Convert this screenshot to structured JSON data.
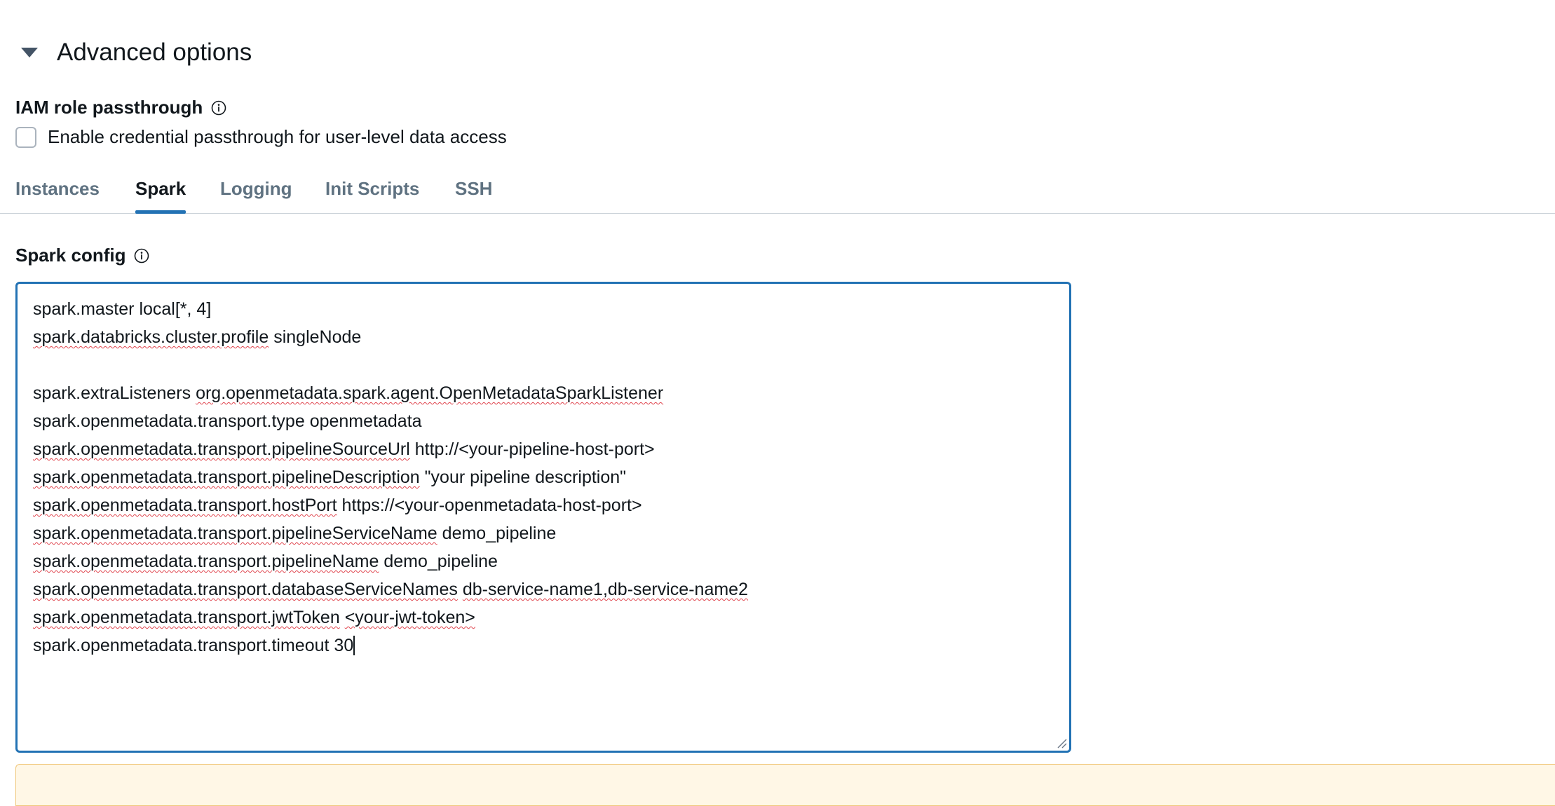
{
  "advanced_options": {
    "title": "Advanced options"
  },
  "iam": {
    "label": "IAM role passthrough",
    "checkbox_label": "Enable credential passthrough for user-level data access",
    "checked": false
  },
  "tabs": [
    {
      "label": "Instances",
      "active": false
    },
    {
      "label": "Spark",
      "active": true
    },
    {
      "label": "Logging",
      "active": false
    },
    {
      "label": "Init Scripts",
      "active": false
    },
    {
      "label": "SSH",
      "active": false
    }
  ],
  "spark_config": {
    "label": "Spark config",
    "lines": [
      {
        "key": "spark.master",
        "value": "local[*, 4]"
      },
      {
        "key": "spark.databricks.cluster.profile",
        "value": "singleNode"
      },
      {
        "key": "",
        "value": ""
      },
      {
        "key": "spark.extraListeners",
        "value": "org.openmetadata.spark.agent.OpenMetadataSparkListener"
      },
      {
        "key": "spark.openmetadata.transport.type",
        "value": "openmetadata"
      },
      {
        "key": "spark.openmetadata.transport.pipelineSourceUrl",
        "value": "http://<your-pipeline-host-port>"
      },
      {
        "key": "spark.openmetadata.transport.pipelineDescription",
        "value": "\"your pipeline description\""
      },
      {
        "key": "spark.openmetadata.transport.hostPort",
        "value": "https://<your-openmetadata-host-port>"
      },
      {
        "key": "spark.openmetadata.transport.pipelineServiceName",
        "value": "demo_pipeline"
      },
      {
        "key": "spark.openmetadata.transport.pipelineName",
        "value": "demo_pipeline"
      },
      {
        "key": "spark.openmetadata.transport.databaseServiceNames",
        "value": "db-service-name1,db-service-name2"
      },
      {
        "key": "spark.openmetadata.transport.jwtToken",
        "value": "<your-jwt-token>"
      },
      {
        "key": "spark.openmetadata.transport.timeout",
        "value": "30"
      }
    ]
  },
  "colors": {
    "accent": "#2272b4",
    "spellcheck": "#e0454e",
    "warning_bg": "#fff7e6"
  }
}
